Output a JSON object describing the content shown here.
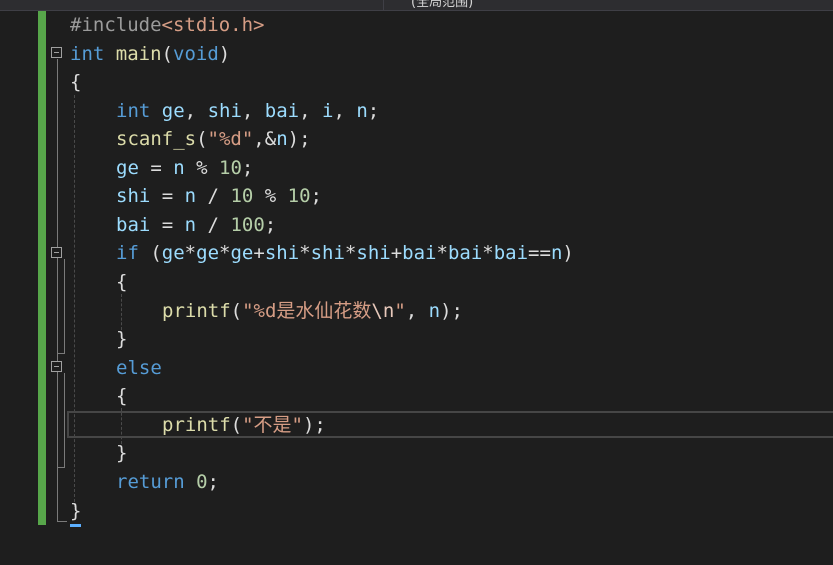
{
  "tab": {
    "label": "(全局范围)"
  },
  "code": {
    "l1": {
      "hash": "#include",
      "header": "<stdio.h>"
    },
    "l2": {
      "type": "int",
      "name": "main",
      "open": "(",
      "param": "void",
      "close": ")"
    },
    "l3": {
      "brace": "{"
    },
    "l4": {
      "type": "int",
      "v1": "ge",
      "c1": ", ",
      "v2": "shi",
      "c2": ", ",
      "v3": "bai",
      "c3": ", ",
      "v4": "i",
      "c4": ", ",
      "v5": "n",
      "end": ";"
    },
    "l5": {
      "fn": "scanf_s",
      "open": "(",
      "str": "\"%d\"",
      "mid": ",&",
      "arg": "n",
      "end": ");"
    },
    "l6": {
      "v": "ge",
      "op": " = ",
      "n": "n",
      "op2": " % ",
      "num": "10",
      "end": ";"
    },
    "l7": {
      "v": "shi",
      "op": " = ",
      "n": "n",
      "op2": " / ",
      "num1": "10",
      "op3": " % ",
      "num2": "10",
      "end": ";"
    },
    "l8": {
      "v": "bai",
      "op": " = ",
      "n": "n",
      "op2": " / ",
      "num": "100",
      "end": ";"
    },
    "l9": {
      "kw": "if",
      "open": " (",
      "a1": "ge",
      "m1": "*",
      "a2": "ge",
      "m2": "*",
      "a3": "ge",
      "p1": "+",
      "b1": "shi",
      "m3": "*",
      "b2": "shi",
      "m4": "*",
      "b3": "shi",
      "p2": "+",
      "c1": "bai",
      "m5": "*",
      "c2": "bai",
      "m6": "*",
      "c3": "bai",
      "eq": "==",
      "n": "n",
      "close": ")"
    },
    "l10": {
      "brace": "{"
    },
    "l11": {
      "fn": "printf",
      "open": "(",
      "str1": "\"%d是水仙花数",
      "esc": "\\n",
      "str2": "\"",
      "sep": ", ",
      "arg": "n",
      "end": ");"
    },
    "l12": {
      "brace": "}"
    },
    "l13": {
      "kw": "else"
    },
    "l14": {
      "brace": "{"
    },
    "l15": {
      "fn": "printf",
      "open": "(",
      "str": "\"不是\"",
      "end": ");"
    },
    "l16": {
      "brace": "}"
    },
    "l17": {
      "kw": "return",
      "sp": " ",
      "num": "0",
      "end": ";"
    },
    "l18": {
      "brace": "}"
    }
  }
}
